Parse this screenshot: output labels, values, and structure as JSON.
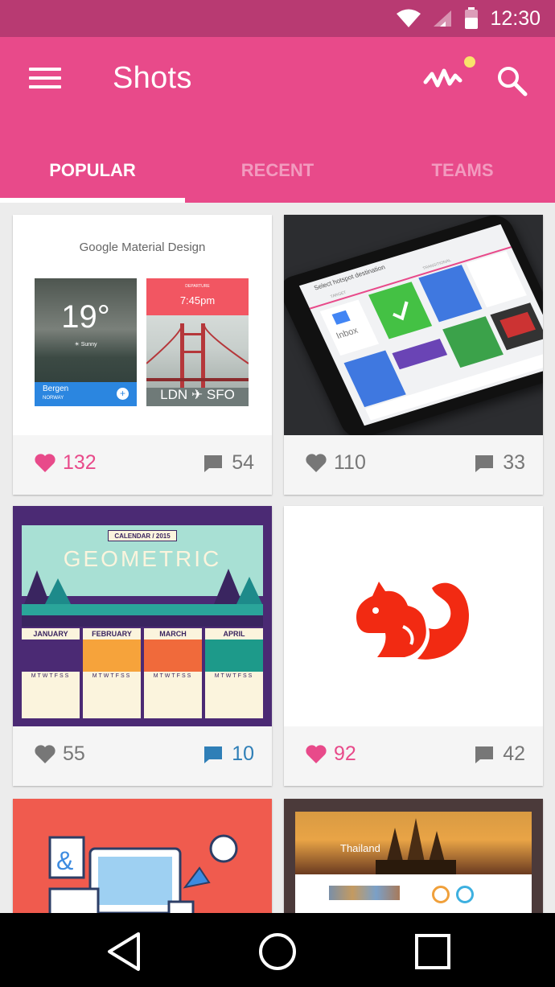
{
  "status_bar": {
    "time": "12:30",
    "icons": [
      "wifi-icon",
      "signal-icon",
      "battery-icon"
    ]
  },
  "app_bar": {
    "title": "Shots",
    "color": "#e84a8a",
    "status_color": "#b83a72",
    "notification_dot_color": "#f9e36b"
  },
  "tabs": [
    {
      "label": "POPULAR",
      "active": true
    },
    {
      "label": "RECENT",
      "active": false
    },
    {
      "label": "TEAMS",
      "active": false
    }
  ],
  "shots": [
    {
      "thumb": "material-design",
      "header": "Google Material Design",
      "temperature": "19°",
      "weather": "Sunny",
      "city": "Bergen",
      "country": "NORWAY",
      "departure_label": "DEPARTURE",
      "departure_time": "7:45pm",
      "route_from": "LDN",
      "route_to": "SFO",
      "likes": "132",
      "liked": true,
      "comments": "54"
    },
    {
      "thumb": "phone-mockup",
      "screen_title": "Select hotspot destination",
      "tab_left": "TARGET",
      "tab_right": "TRANSITIONAL",
      "app_label": "Inbox",
      "likes": "110",
      "liked": false,
      "comments": "33"
    },
    {
      "thumb": "geometric-calendar",
      "banner": "CALENDAR / 2015",
      "headline": "GEOMETRIC",
      "months": [
        "JANUARY",
        "FEBRUARY",
        "MARCH",
        "APRIL"
      ],
      "weekdays": "MTWTFSS",
      "likes": "55",
      "liked": false,
      "comments": "10",
      "comment_active": true
    },
    {
      "thumb": "squirrel-logo",
      "likes": "92",
      "liked": true,
      "comments": "42"
    },
    {
      "thumb": "workspace-illustration"
    },
    {
      "thumb": "thailand-site",
      "site_title": "Thailand"
    }
  ]
}
